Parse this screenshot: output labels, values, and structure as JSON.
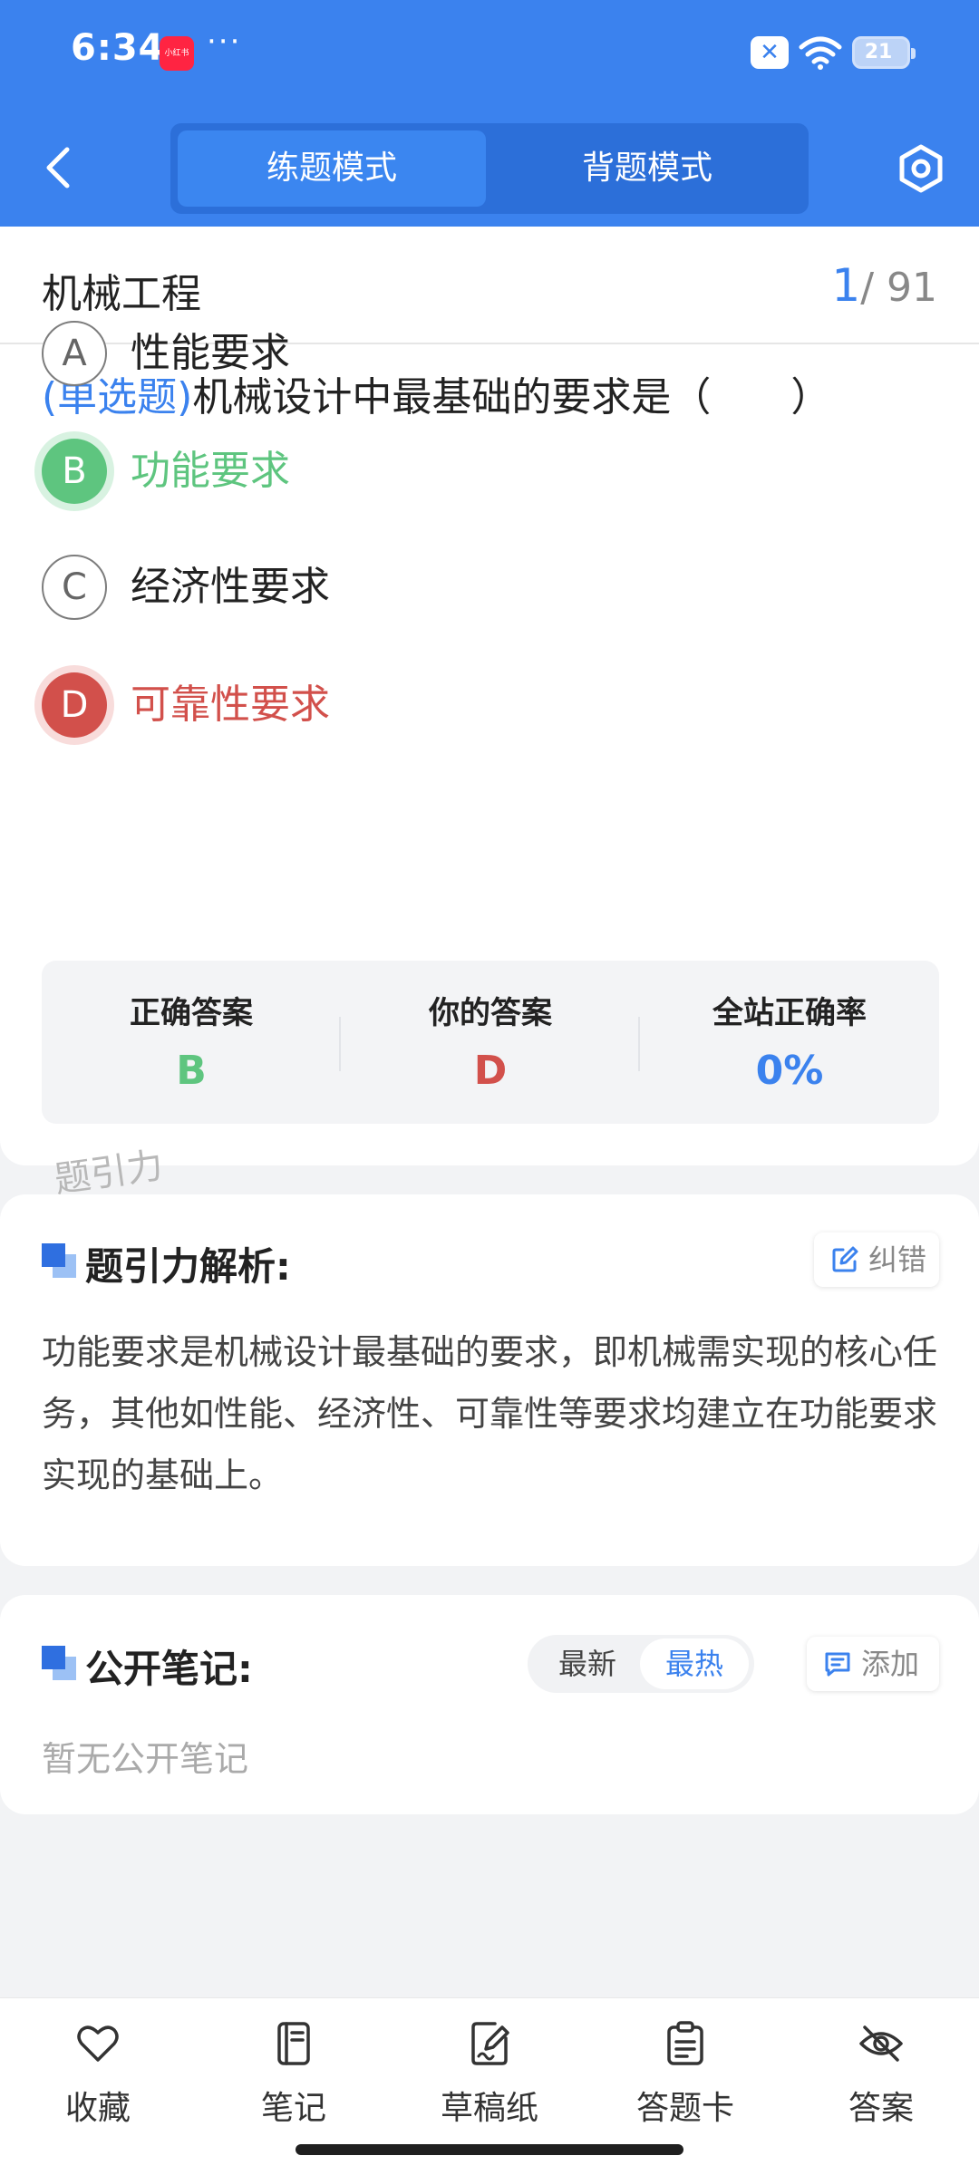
{
  "status_bar": {
    "time": "6:34",
    "app_badge": "小红书",
    "dots": "···",
    "notif_icon": "x-icon",
    "battery": "21"
  },
  "header": {
    "tabs": [
      {
        "label": "练题模式",
        "active": true
      },
      {
        "label": "背题模式",
        "active": false
      }
    ]
  },
  "question": {
    "subject": "机械工程",
    "current": "1",
    "total": "/ 91",
    "type": "(单选题)",
    "text": "机械设计中最基础的要求是（　　）",
    "options": [
      {
        "letter": "A",
        "text": "性能要求",
        "state": "normal"
      },
      {
        "letter": "B",
        "text": "功能要求",
        "state": "correct"
      },
      {
        "letter": "C",
        "text": "经济性要求",
        "state": "normal"
      },
      {
        "letter": "D",
        "text": "可靠性要求",
        "state": "wrong"
      }
    ]
  },
  "stats": {
    "correct_label": "正确答案",
    "correct_value": "B",
    "yours_label": "你的答案",
    "yours_value": "D",
    "rate_label": "全站正确率",
    "rate_value": "0%"
  },
  "watermark": "题引力",
  "analysis": {
    "title": "题引力解析:",
    "report_label": "纠错",
    "text": "功能要求是机械设计最基础的要求，即机械需实现的核心任务，其他如性能、经济性、可靠性等要求均建立在功能要求实现的基础上。"
  },
  "notes": {
    "title": "公开笔记:",
    "sort_newest": "最新",
    "sort_hottest": "最热",
    "add_label": "添加",
    "empty_text": "暂无公开笔记"
  },
  "bottom_nav": [
    {
      "label": "收藏",
      "icon": "heart-icon"
    },
    {
      "label": "笔记",
      "icon": "notebook-icon"
    },
    {
      "label": "草稿纸",
      "icon": "draft-icon"
    },
    {
      "label": "答题卡",
      "icon": "clipboard-icon"
    },
    {
      "label": "答案",
      "icon": "eye-off-icon"
    }
  ],
  "colors": {
    "primary": "#3b82ee",
    "correct": "#5ec57f",
    "wrong": "#d2504b"
  }
}
